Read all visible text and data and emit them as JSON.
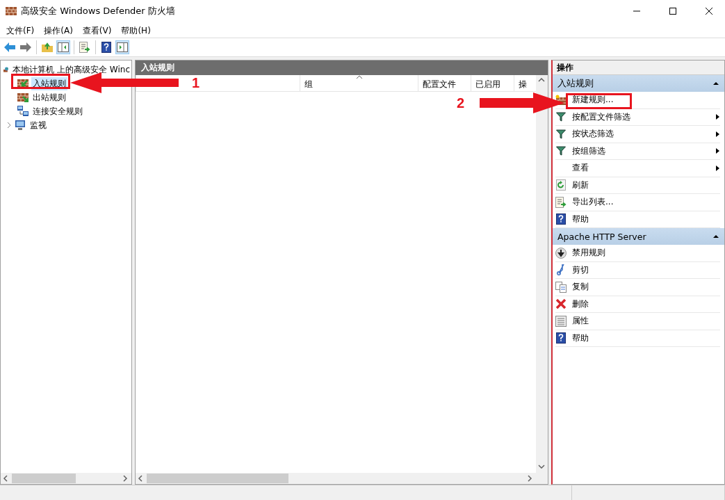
{
  "window": {
    "title": "高级安全 Windows Defender 防火墙"
  },
  "menu": [
    {
      "label": "文件(F)"
    },
    {
      "label": "操作(A)"
    },
    {
      "label": "查看(V)"
    },
    {
      "label": "帮助(H)"
    }
  ],
  "tree": {
    "root": "本地计算机 上的高级安全 Winc",
    "items": [
      {
        "label": "入站规则",
        "kind": "inbound",
        "selected": true
      },
      {
        "label": "出站规则",
        "kind": "outbound",
        "selected": false
      },
      {
        "label": "连接安全规则",
        "kind": "connection",
        "selected": false
      },
      {
        "label": "监视",
        "kind": "monitor",
        "selected": false,
        "expanded": false
      }
    ]
  },
  "center": {
    "title": "入站规则",
    "columns": [
      {
        "label": "组",
        "sorted": true
      },
      {
        "label": "配置文件",
        "sorted": false
      },
      {
        "label": "已启用",
        "sorted": false
      },
      {
        "label": "操",
        "sorted": false
      }
    ]
  },
  "actions": {
    "title": "操作",
    "sections": [
      {
        "title": "入站规则",
        "items": [
          {
            "label": "新建规则...",
            "kind": "new",
            "submenu": false
          },
          {
            "label": "按配置文件筛选",
            "kind": "filter",
            "submenu": true
          },
          {
            "label": "按状态筛选",
            "kind": "filter",
            "submenu": true
          },
          {
            "label": "按组筛选",
            "kind": "filter",
            "submenu": true
          },
          {
            "label": "查看",
            "kind": "none",
            "submenu": true
          },
          {
            "label": "刷新",
            "kind": "refresh",
            "submenu": false
          },
          {
            "label": "导出列表...",
            "kind": "export",
            "submenu": false
          },
          {
            "label": "帮助",
            "kind": "help",
            "submenu": false
          }
        ]
      },
      {
        "title": "Apache HTTP Server",
        "items": [
          {
            "label": "禁用规则",
            "kind": "disable",
            "submenu": false
          },
          {
            "label": "剪切",
            "kind": "cut",
            "submenu": false
          },
          {
            "label": "复制",
            "kind": "copy",
            "submenu": false
          },
          {
            "label": "删除",
            "kind": "delete",
            "submenu": false
          },
          {
            "label": "属性",
            "kind": "properties",
            "submenu": false
          },
          {
            "label": "帮助",
            "kind": "help",
            "submenu": false
          }
        ]
      }
    ]
  },
  "annotations": [
    {
      "number": "1"
    },
    {
      "number": "2"
    }
  ]
}
